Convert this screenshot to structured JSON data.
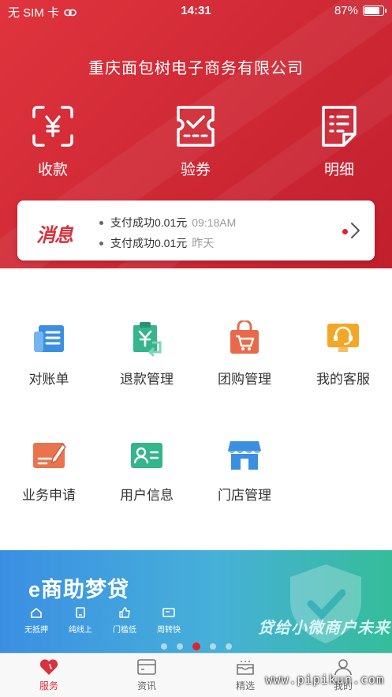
{
  "status_bar": {
    "carrier": "无 SIM 卡",
    "time": "14:31",
    "battery": "87%",
    "battery_level": 0.87
  },
  "header": {
    "company": "重庆面包树电子商务有限公司"
  },
  "top_actions": [
    {
      "icon": "receipt-yuan-scan-icon",
      "label": "收款"
    },
    {
      "icon": "ticket-check-icon",
      "label": "验券"
    },
    {
      "icon": "document-list-icon",
      "label": "明细"
    }
  ],
  "messages": {
    "logo": "消息",
    "items": [
      {
        "text": "支付成功0.01元",
        "time": "09:18AM"
      },
      {
        "text": "支付成功0.01元",
        "time": "昨天"
      }
    ]
  },
  "menu": [
    {
      "icon": "statement-icon",
      "label": "对账单",
      "color": "#3a8fe0"
    },
    {
      "icon": "refund-icon",
      "label": "退款管理",
      "color": "#35b58a"
    },
    {
      "icon": "shopping-bag-cart-icon",
      "label": "团购管理",
      "color": "#e86a4a"
    },
    {
      "icon": "customer-service-icon",
      "label": "我的客服",
      "color": "#f2a826"
    },
    {
      "icon": "application-edit-icon",
      "label": "业务申请",
      "color": "#e8734d"
    },
    {
      "icon": "user-card-icon",
      "label": "用户信息",
      "color": "#35b58a"
    },
    {
      "icon": "store-icon",
      "label": "门店管理",
      "color": "#3a8fe0"
    }
  ],
  "banner": {
    "title": "e商助梦贷",
    "features": [
      "无抵押",
      "纯线上",
      "门槛低",
      "周转快"
    ],
    "slogan": "贷给小微商户未来",
    "active_slide": 2,
    "slide_count": 5
  },
  "tabs": [
    {
      "icon": "heart-icon",
      "label": "服务",
      "active": true
    },
    {
      "icon": "news-card-icon",
      "label": "资讯",
      "active": false
    },
    {
      "icon": "tray-icon",
      "label": "精选",
      "active": false
    },
    {
      "icon": "user-icon",
      "label": "我的",
      "active": false
    }
  ],
  "watermark": "www.pipikun.com",
  "colors": {
    "brand_red": "#d9323d",
    "header_red": "#d12a36"
  }
}
